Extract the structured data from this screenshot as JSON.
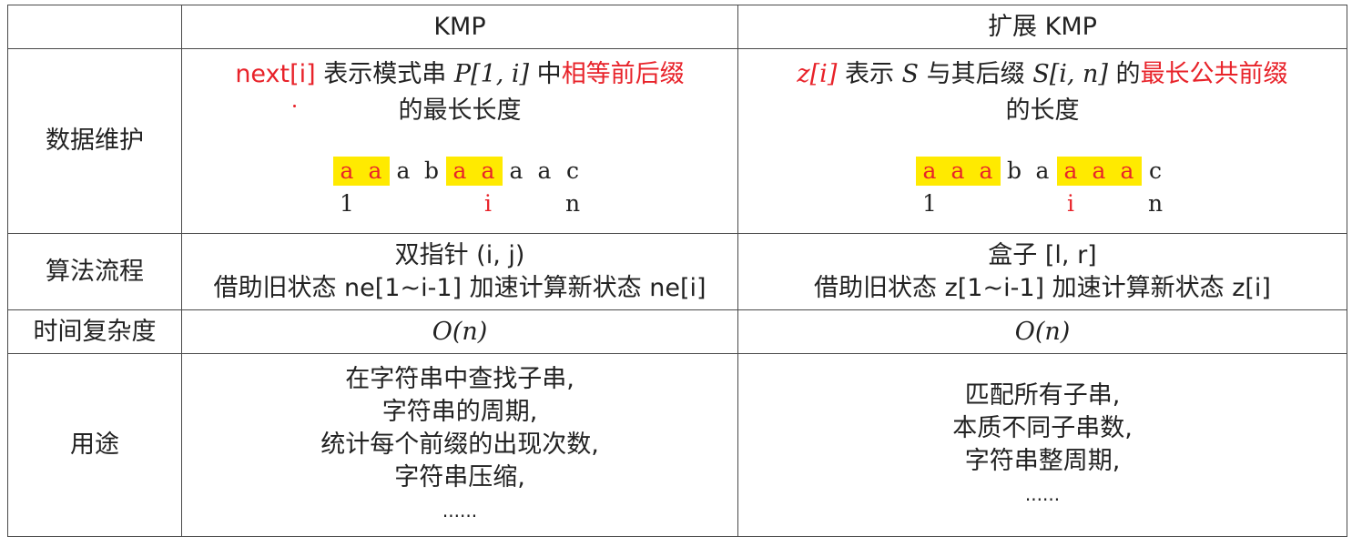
{
  "header": {
    "blank": "",
    "kmp": "KMP",
    "ext": "扩展 KMP"
  },
  "rows": {
    "data": {
      "label": "数据维护",
      "kmp": {
        "part1_red": "next[i]",
        "part2": " 表示模式串 ",
        "math": "P[1, i]",
        "part3": " 中",
        "part4_red": "相等前后缀",
        "line2": "的最长长度",
        "seq": [
          "a",
          "a",
          "a",
          "b",
          "a",
          "a",
          "a",
          "a",
          "c"
        ],
        "seq_highlight": [
          0,
          1,
          4,
          5
        ],
        "idx": {
          "start": "1",
          "i": "i",
          "n": "n"
        }
      },
      "ext": {
        "part1_red_math": "z[i]",
        "part2": " 表示 ",
        "math_s": "S",
        "part3": " 与其后缀 ",
        "math_suffix": "S[i, n]",
        "part4": " 的",
        "part5_red": "最长公共前缀",
        "line2": "的长度",
        "seq": [
          "a",
          "a",
          "a",
          "b",
          "a",
          "a",
          "a",
          "a",
          "c"
        ],
        "seq_highlight": [
          0,
          1,
          2,
          5,
          6,
          7
        ],
        "idx": {
          "start": "1",
          "i": "i",
          "n": "n"
        }
      }
    },
    "algo": {
      "label": "算法流程",
      "kmp": {
        "line1": "双指针 (i, j)",
        "line2": "借助旧状态 ne[1~i-1] 加速计算新状态 ne[i]"
      },
      "ext": {
        "line1": "盒子 [l, r]",
        "line2": "借助旧状态 z[1~i-1] 加速计算新状态 z[i]"
      }
    },
    "time": {
      "label": "时间复杂度",
      "kmp": "O(n)",
      "ext": "O(n)"
    },
    "use": {
      "label": "用途",
      "kmp": [
        "在字符串中查找子串,",
        "字符串的周期,",
        "统计每个前缀的出现次数,",
        "字符串压缩,",
        "......"
      ],
      "ext": [
        "匹配所有子串,",
        "本质不同子串数,",
        "字符串整周期,",
        "......"
      ]
    }
  },
  "colors": {
    "red": "#e8232a",
    "highlight": "#ffea00",
    "border": "#4a4a4a"
  }
}
